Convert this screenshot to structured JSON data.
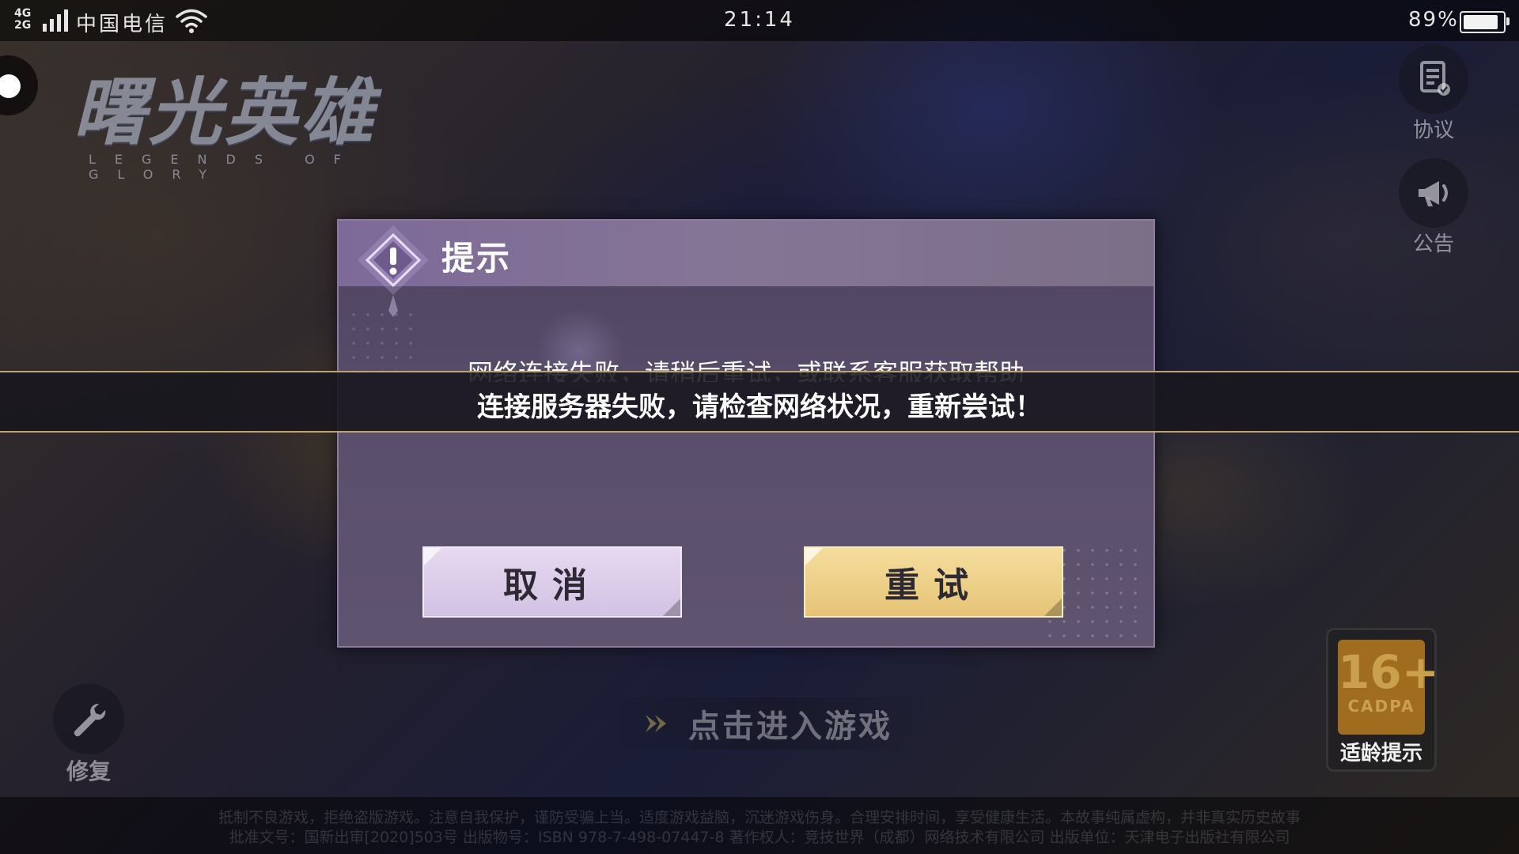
{
  "status_bar": {
    "network_top": "4G",
    "network_bottom": "2G",
    "carrier": "中国电信",
    "time": "21:14",
    "battery_text": "89%",
    "battery_level": 0.89
  },
  "logo": {
    "title": "曙光英雄",
    "subtitle": "LEGENDS OF GLORY"
  },
  "side_buttons": {
    "agreement_label": "协议",
    "announcement_label": "公告"
  },
  "dialog": {
    "title": "提示",
    "message": "网络连接失败，请稍后重试，或联系客服获取帮助",
    "cancel_label": "取消",
    "retry_label": "重试"
  },
  "toast": {
    "text": "连接服务器失败，请检查网络状况，重新尝试！"
  },
  "bottom": {
    "repair_label": "修复",
    "enter_game_label": "点击进入游戏",
    "age_rating": "16+",
    "age_org": "CADPA",
    "age_label": "适龄提示"
  },
  "footer": {
    "line1": "抵制不良游戏，拒绝盗版游戏。注意自我保护，谨防受骗上当。适度游戏益脑，沉迷游戏伤身。合理安排时间，享受健康生活。本故事纯属虚构，并非真实历史故事",
    "line2": "批准文号：国新出审[2020]503号  出版物号：ISBN 978-7-498-07447-8  著作权人：竞技世界（成都）网络技术有限公司  出版单位：天津电子出版社有限公司"
  },
  "colors": {
    "dialog_bg": "#5a4f6c",
    "dialog_header": "#7d6a98",
    "cancel_button": "#d9cbe8",
    "retry_button": "#edcf88",
    "toast_border": "#bfa36a"
  }
}
